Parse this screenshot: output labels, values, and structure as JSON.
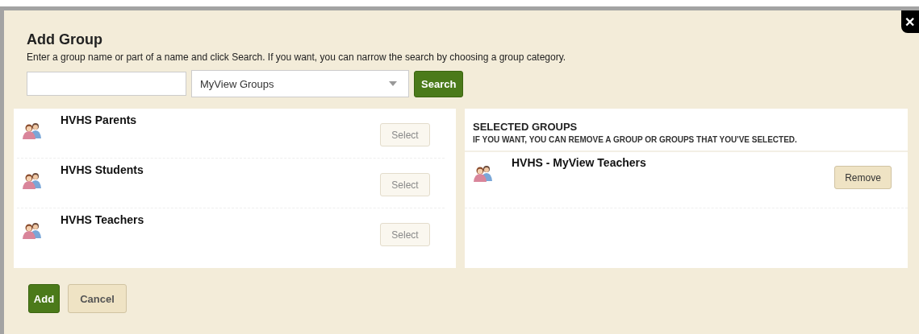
{
  "dialog": {
    "title": "Add Group",
    "close_glyph": "✕",
    "description": "Enter a group name or part of a name and click Search. If you want, you can narrow the search by choosing a group category."
  },
  "search": {
    "category": "MyView Groups",
    "button": "Search"
  },
  "results": [
    {
      "name": "HVHS Parents",
      "button": "Select",
      "disabled": true
    },
    {
      "name": "HVHS Students",
      "button": "Select",
      "disabled": true
    },
    {
      "name": "HVHS Teachers",
      "button": "Select",
      "disabled": true
    }
  ],
  "selected_panel": {
    "title": "SELECTED GROUPS",
    "subtitle": "IF YOU WANT, YOU CAN REMOVE A GROUP OR GROUPS THAT YOU'VE SELECTED.",
    "groups": [
      {
        "name": "HVHS - MyView Teachers",
        "button": "Remove",
        "disabled": false
      }
    ]
  },
  "footer": {
    "primary": "Add",
    "secondary": "Cancel"
  }
}
